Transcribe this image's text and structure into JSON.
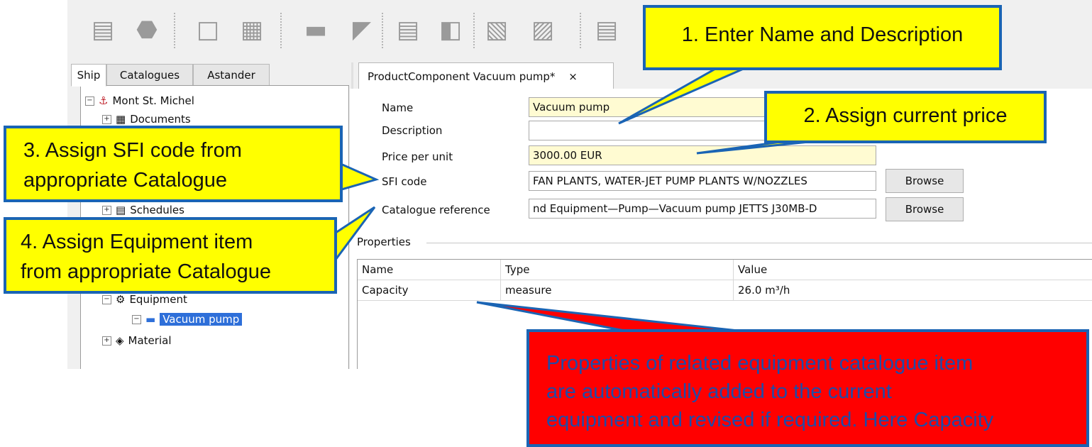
{
  "toolbar": {
    "icons": [
      "save-icon",
      "stop-icon",
      "new-catalogue-item-icon",
      "book-icon",
      "ship-icon",
      "edit-ship-icon",
      "new-list-icon",
      "edit-list-icon",
      "new-document-icon",
      "edit-document-icon",
      "save-all-icon"
    ]
  },
  "left_tabs": [
    "Ship",
    "Catalogues",
    "Astander"
  ],
  "tree": {
    "root": "Mont St. Michel",
    "documents": "Documents",
    "schedules": "Schedules",
    "equipment": "Equipment",
    "selected": "Vacuum pump",
    "material": "Material"
  },
  "editor_tab": {
    "label": "ProductComponent Vacuum pump*",
    "close": "×"
  },
  "form": {
    "name_label": "Name",
    "name_value": "Vacuum pump",
    "description_label": "Description",
    "description_value": "",
    "price_label": "Price per unit",
    "price_value": "3000.00 EUR",
    "sfi_label": "SFI code",
    "sfi_value": "FAN PLANTS, WATER-JET PUMP PLANTS W/NOZZLES",
    "catalogue_label": "Catalogue reference",
    "catalogue_value": "nd Equipment—Pump—Vacuum pump JETTS J30MB-D",
    "browse_label": "Browse"
  },
  "properties": {
    "title": "Properties",
    "headers": [
      "Name",
      "Type",
      "Value"
    ],
    "rows": [
      [
        "Capacity",
        "measure",
        "26.0 m³/h"
      ]
    ]
  },
  "callouts": {
    "c1": "1. Enter Name and Description",
    "c2": "2. Assign current price",
    "c3_line1": "3. Assign SFI code from",
    "c3_line2": "appropriate Catalogue",
    "c4_line1": "4. Assign Equipment item",
    "c4_line2": "from appropriate Catalogue",
    "c5_line1": "Properties of related equipment catalogue item",
    "c5_line2": "are automatically added to the current",
    "c5_line3": "equipment and revised if required. Here Capacity"
  },
  "colors": {
    "callout_yellow": "#ffff00",
    "callout_red": "#ff0000",
    "callout_border": "#1a64b4",
    "selection_blue": "#2e6fd9",
    "input_yellow": "#fffbd2"
  }
}
